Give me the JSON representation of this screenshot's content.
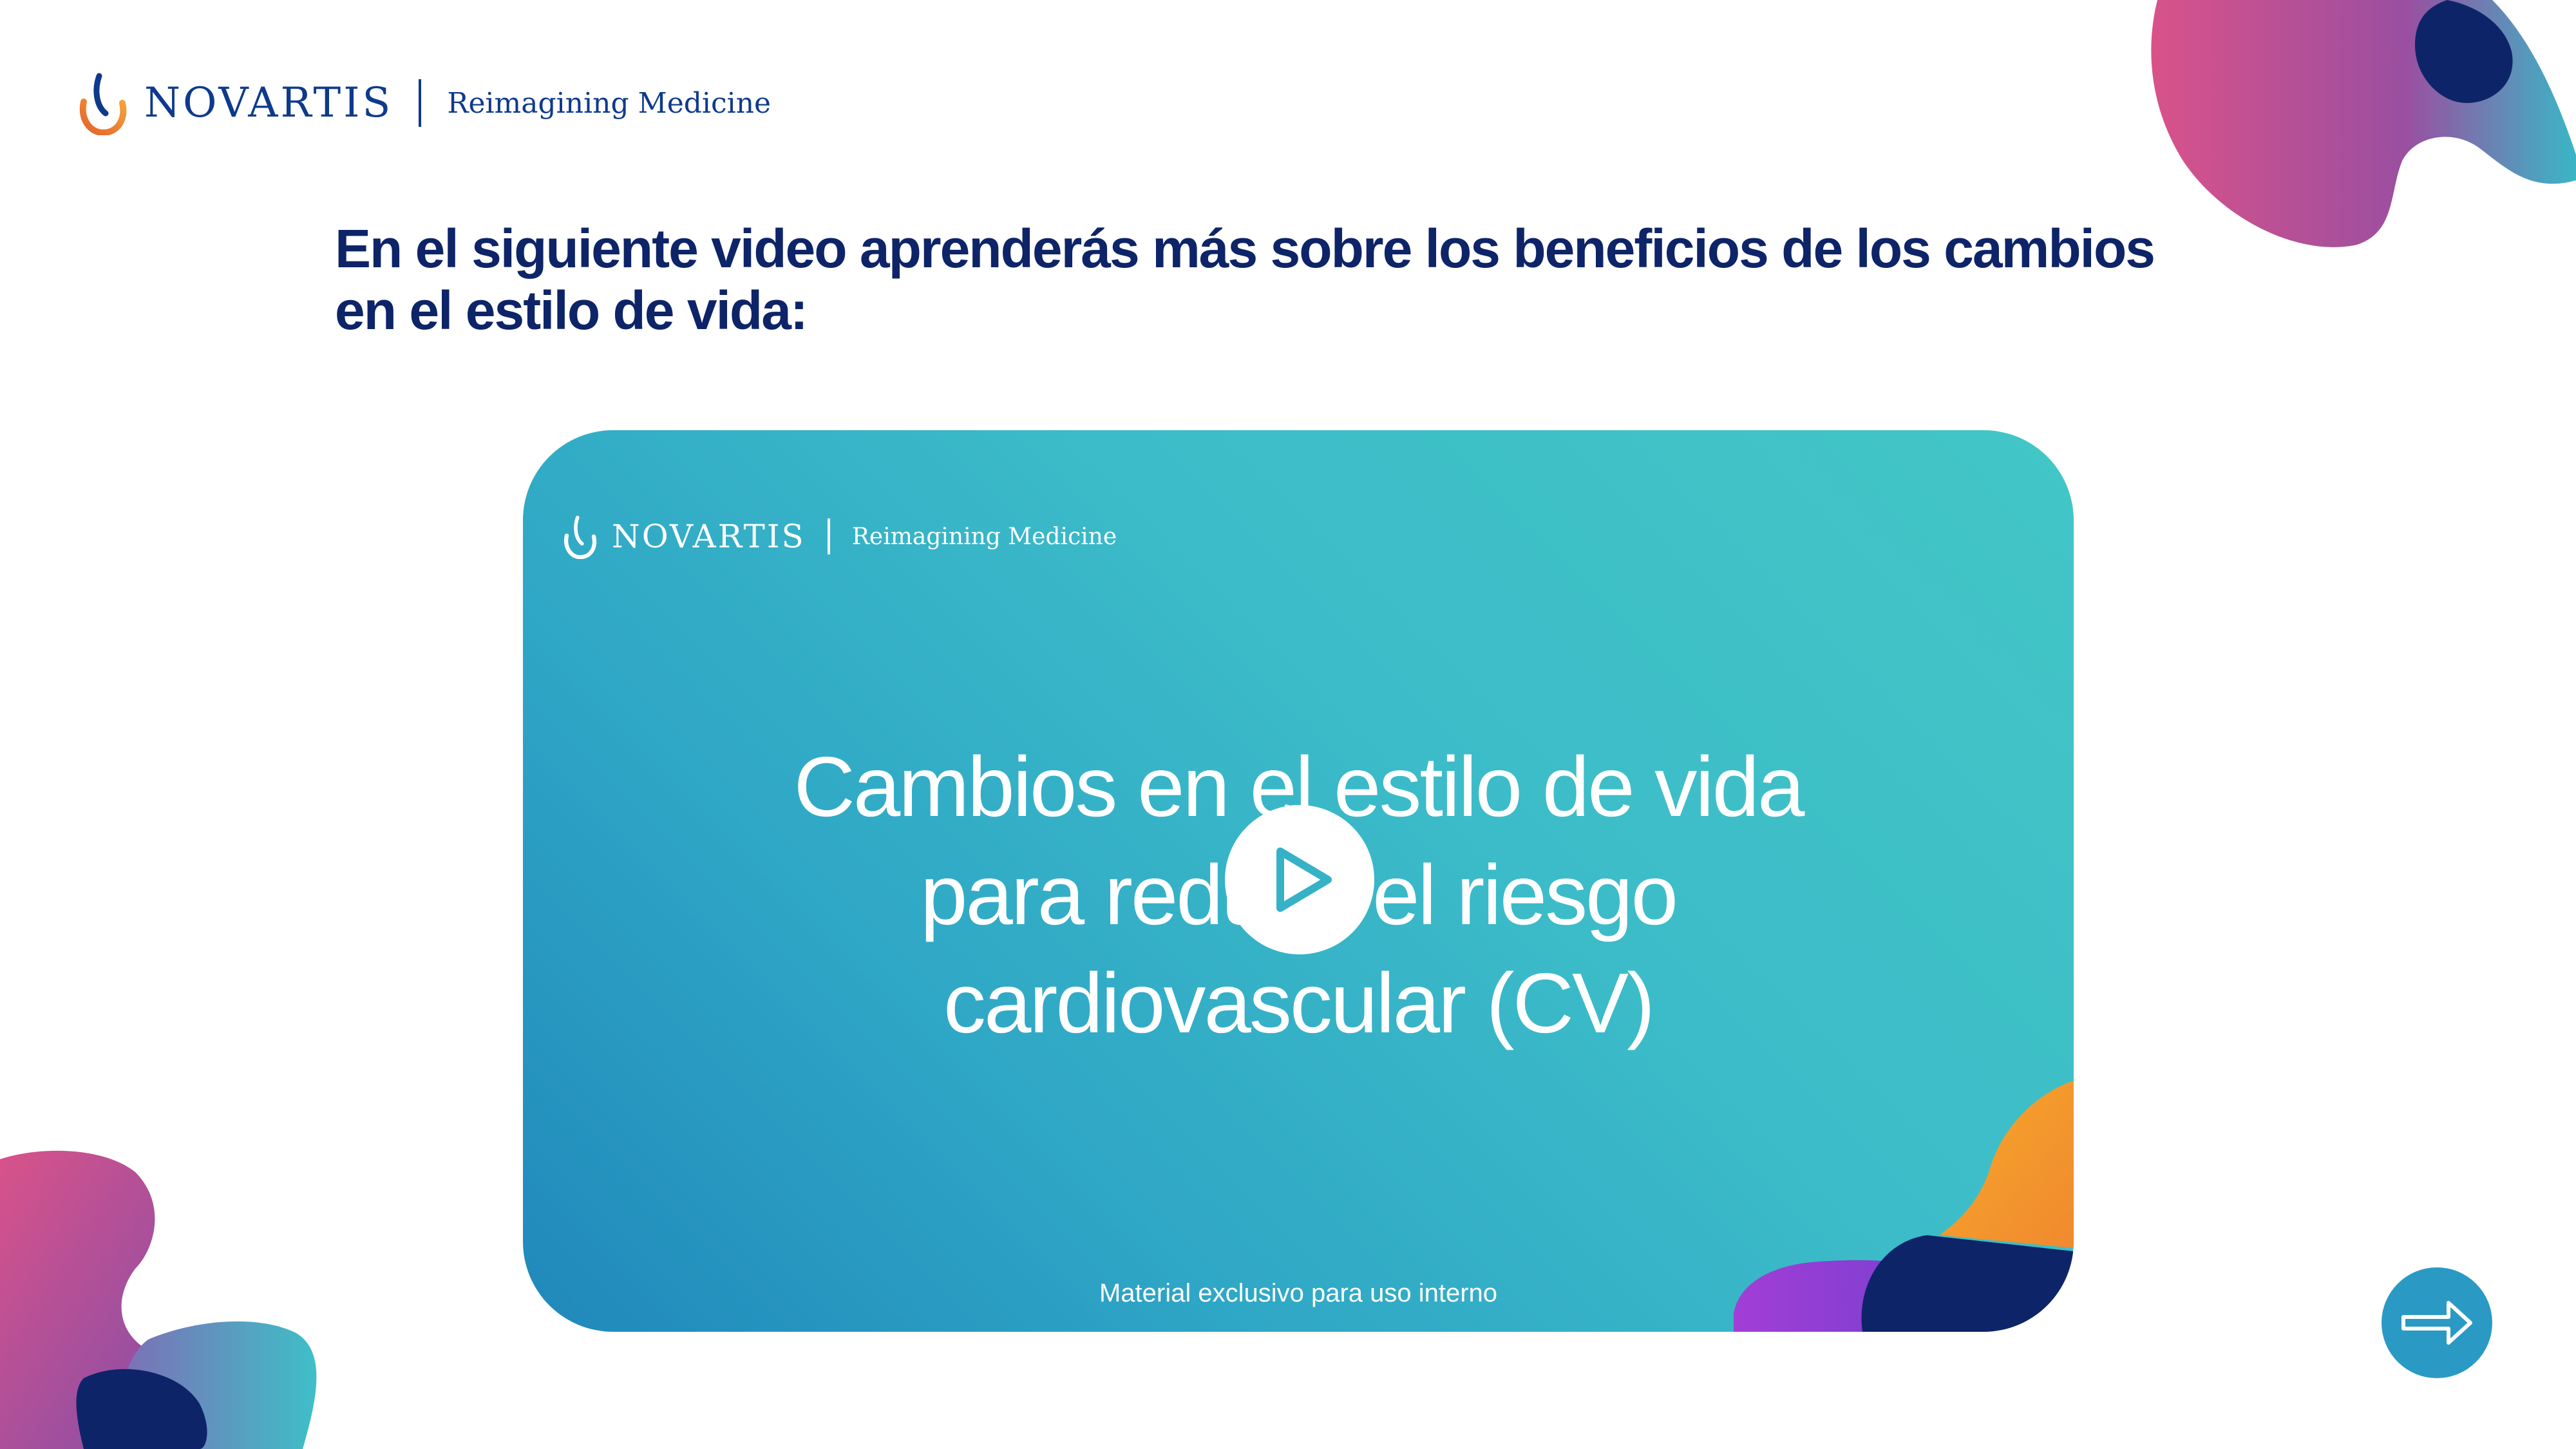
{
  "header": {
    "brand": "NOVARTIS",
    "tagline": "Reimagining Medicine"
  },
  "heading": {
    "line1": "En el siguiente video aprenderás más sobre los beneficios de los cambios",
    "line2": "en el estilo de vida:"
  },
  "video": {
    "brand": "NOVARTIS",
    "tagline": "Reimagining Medicine",
    "title_lines": [
      "Cambios en el estilo de vida",
      "para reducir el riesgo",
      "cardiovascular (CV)"
    ],
    "footer": "Material exclusivo para uso interno",
    "play_icon": "play-icon"
  },
  "navigation": {
    "next_icon": "arrow-right-icon"
  },
  "colors": {
    "navy": "#0e2468",
    "brand_blue": "#0e3a8c",
    "teal": "#3ebfc8",
    "magenta": "#d9528a",
    "purple": "#9a4fa0",
    "orange": "#f29232"
  }
}
